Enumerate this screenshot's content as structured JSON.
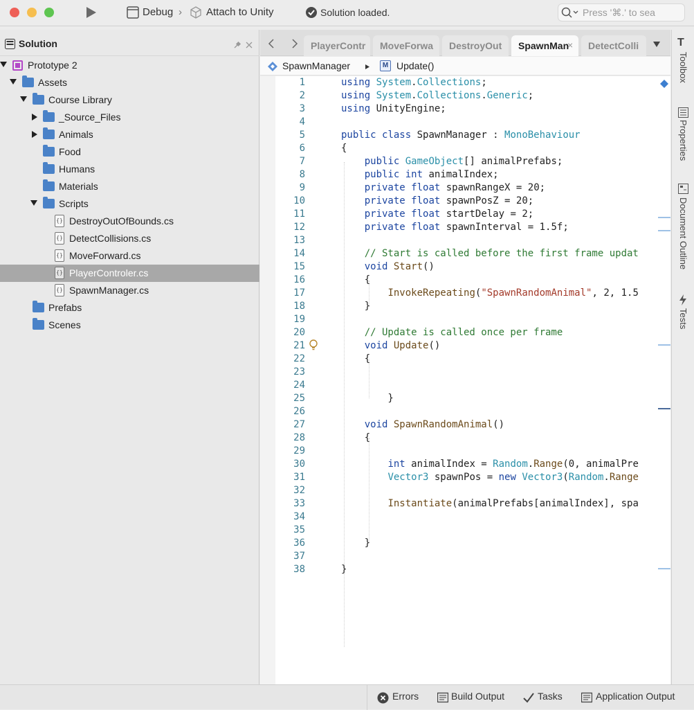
{
  "toolbar": {
    "run_icon": "play-icon",
    "config": "Debug",
    "target": "Attach to Unity",
    "status": "Solution loaded.",
    "search_placeholder": "Press '⌘.' to sea"
  },
  "solution": {
    "title": "Solution",
    "tree": [
      {
        "label": "Prototype 2",
        "kind": "project",
        "level": 0,
        "expanded": true
      },
      {
        "label": "Assets",
        "kind": "folder",
        "level": 1,
        "expanded": true
      },
      {
        "label": "Course Library",
        "kind": "folder",
        "level": 2,
        "expanded": true
      },
      {
        "label": "_Source_Files",
        "kind": "folder",
        "level": 3,
        "expanded": false
      },
      {
        "label": "Animals",
        "kind": "folder",
        "level": 3,
        "expanded": false
      },
      {
        "label": "Food",
        "kind": "folder",
        "level": 3
      },
      {
        "label": "Humans",
        "kind": "folder",
        "level": 3
      },
      {
        "label": "Materials",
        "kind": "folder",
        "level": 3
      },
      {
        "label": "Scripts",
        "kind": "folder",
        "level": 3,
        "expanded": true
      },
      {
        "label": "DestroyOutOfBounds.cs",
        "kind": "file",
        "level": 4
      },
      {
        "label": "DetectCollisions.cs",
        "kind": "file",
        "level": 4
      },
      {
        "label": "MoveForward.cs",
        "kind": "file",
        "level": 4
      },
      {
        "label": "PlayerControler.cs",
        "kind": "file",
        "level": 4,
        "selected": true
      },
      {
        "label": "SpawnManager.cs",
        "kind": "file",
        "level": 4
      },
      {
        "label": "Prefabs",
        "kind": "folder",
        "level": 2
      },
      {
        "label": "Scenes",
        "kind": "folder",
        "level": 2
      }
    ]
  },
  "tabs": [
    {
      "label": "PlayerContr",
      "active": false
    },
    {
      "label": "MoveForwa",
      "active": false
    },
    {
      "label": "DestroyOut",
      "active": false
    },
    {
      "label": "SpawnMan",
      "active": true
    },
    {
      "label": "DetectColli",
      "active": false
    }
  ],
  "path": {
    "class": "SpawnManager",
    "member": "Update()"
  },
  "code_lines": [
    "using System.Collections;",
    "using System.Collections.Generic;",
    "using UnityEngine;",
    "",
    "public class SpawnManager : MonoBehaviour",
    "{",
    "    public GameObject[] animalPrefabs;",
    "    public int animalIndex;",
    "    private float spawnRangeX = 20;",
    "    private float spawnPosZ = 20;",
    "    private float startDelay = 2;",
    "    private float spawnInterval = 1.5f;",
    "",
    "    // Start is called before the first frame updat",
    "    void Start()",
    "    {",
    "        InvokeRepeating(\"SpawnRandomAnimal\", 2, 1.5",
    "    }",
    "",
    "    // Update is called once per frame",
    "    void Update()",
    "    {",
    "",
    "",
    "        }",
    "",
    "    void SpawnRandomAnimal()",
    "    {",
    "",
    "        int animalIndex = Random.Range(0, animalPre",
    "        Vector3 spawnPos = new Vector3(Random.Range",
    "",
    "        Instantiate(animalPrefabs[animalIndex], spa",
    "",
    "",
    "    }",
    "",
    "}"
  ],
  "right_panels": [
    "Toolbox",
    "Properties",
    "Document Outline",
    "Tests"
  ],
  "status_items": [
    "Errors",
    "Build Output",
    "Tasks",
    "Application Output"
  ],
  "colors": {
    "close": "#ee5f57",
    "minimize": "#f6be4f",
    "maximize": "#5ec551",
    "folder": "#4a82c8",
    "keyword": "#1c45a0",
    "type": "#2a8fa8",
    "comment": "#2f7a34",
    "string": "#a33a2a"
  }
}
